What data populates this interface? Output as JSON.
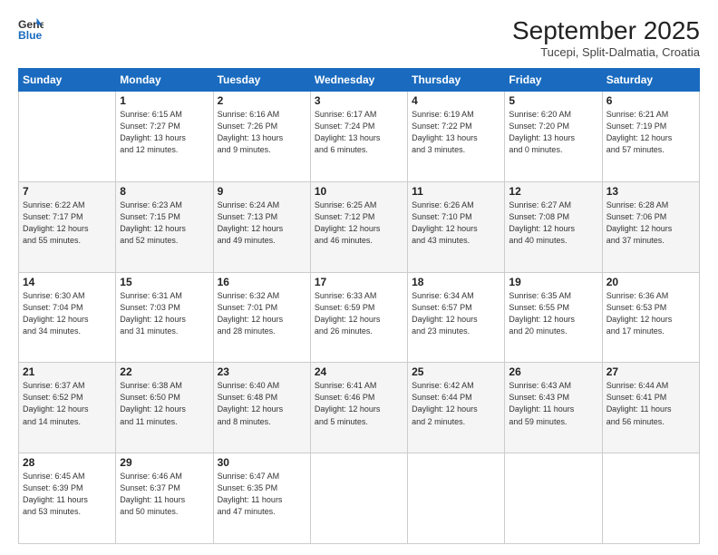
{
  "header": {
    "logo_line1": "General",
    "logo_line2": "Blue",
    "month_title": "September 2025",
    "subtitle": "Tucepi, Split-Dalmatia, Croatia"
  },
  "weekdays": [
    "Sunday",
    "Monday",
    "Tuesday",
    "Wednesday",
    "Thursday",
    "Friday",
    "Saturday"
  ],
  "weeks": [
    [
      {
        "day": "",
        "info": ""
      },
      {
        "day": "1",
        "info": "Sunrise: 6:15 AM\nSunset: 7:27 PM\nDaylight: 13 hours\nand 12 minutes."
      },
      {
        "day": "2",
        "info": "Sunrise: 6:16 AM\nSunset: 7:26 PM\nDaylight: 13 hours\nand 9 minutes."
      },
      {
        "day": "3",
        "info": "Sunrise: 6:17 AM\nSunset: 7:24 PM\nDaylight: 13 hours\nand 6 minutes."
      },
      {
        "day": "4",
        "info": "Sunrise: 6:19 AM\nSunset: 7:22 PM\nDaylight: 13 hours\nand 3 minutes."
      },
      {
        "day": "5",
        "info": "Sunrise: 6:20 AM\nSunset: 7:20 PM\nDaylight: 13 hours\nand 0 minutes."
      },
      {
        "day": "6",
        "info": "Sunrise: 6:21 AM\nSunset: 7:19 PM\nDaylight: 12 hours\nand 57 minutes."
      }
    ],
    [
      {
        "day": "7",
        "info": "Sunrise: 6:22 AM\nSunset: 7:17 PM\nDaylight: 12 hours\nand 55 minutes."
      },
      {
        "day": "8",
        "info": "Sunrise: 6:23 AM\nSunset: 7:15 PM\nDaylight: 12 hours\nand 52 minutes."
      },
      {
        "day": "9",
        "info": "Sunrise: 6:24 AM\nSunset: 7:13 PM\nDaylight: 12 hours\nand 49 minutes."
      },
      {
        "day": "10",
        "info": "Sunrise: 6:25 AM\nSunset: 7:12 PM\nDaylight: 12 hours\nand 46 minutes."
      },
      {
        "day": "11",
        "info": "Sunrise: 6:26 AM\nSunset: 7:10 PM\nDaylight: 12 hours\nand 43 minutes."
      },
      {
        "day": "12",
        "info": "Sunrise: 6:27 AM\nSunset: 7:08 PM\nDaylight: 12 hours\nand 40 minutes."
      },
      {
        "day": "13",
        "info": "Sunrise: 6:28 AM\nSunset: 7:06 PM\nDaylight: 12 hours\nand 37 minutes."
      }
    ],
    [
      {
        "day": "14",
        "info": "Sunrise: 6:30 AM\nSunset: 7:04 PM\nDaylight: 12 hours\nand 34 minutes."
      },
      {
        "day": "15",
        "info": "Sunrise: 6:31 AM\nSunset: 7:03 PM\nDaylight: 12 hours\nand 31 minutes."
      },
      {
        "day": "16",
        "info": "Sunrise: 6:32 AM\nSunset: 7:01 PM\nDaylight: 12 hours\nand 28 minutes."
      },
      {
        "day": "17",
        "info": "Sunrise: 6:33 AM\nSunset: 6:59 PM\nDaylight: 12 hours\nand 26 minutes."
      },
      {
        "day": "18",
        "info": "Sunrise: 6:34 AM\nSunset: 6:57 PM\nDaylight: 12 hours\nand 23 minutes."
      },
      {
        "day": "19",
        "info": "Sunrise: 6:35 AM\nSunset: 6:55 PM\nDaylight: 12 hours\nand 20 minutes."
      },
      {
        "day": "20",
        "info": "Sunrise: 6:36 AM\nSunset: 6:53 PM\nDaylight: 12 hours\nand 17 minutes."
      }
    ],
    [
      {
        "day": "21",
        "info": "Sunrise: 6:37 AM\nSunset: 6:52 PM\nDaylight: 12 hours\nand 14 minutes."
      },
      {
        "day": "22",
        "info": "Sunrise: 6:38 AM\nSunset: 6:50 PM\nDaylight: 12 hours\nand 11 minutes."
      },
      {
        "day": "23",
        "info": "Sunrise: 6:40 AM\nSunset: 6:48 PM\nDaylight: 12 hours\nand 8 minutes."
      },
      {
        "day": "24",
        "info": "Sunrise: 6:41 AM\nSunset: 6:46 PM\nDaylight: 12 hours\nand 5 minutes."
      },
      {
        "day": "25",
        "info": "Sunrise: 6:42 AM\nSunset: 6:44 PM\nDaylight: 12 hours\nand 2 minutes."
      },
      {
        "day": "26",
        "info": "Sunrise: 6:43 AM\nSunset: 6:43 PM\nDaylight: 11 hours\nand 59 minutes."
      },
      {
        "day": "27",
        "info": "Sunrise: 6:44 AM\nSunset: 6:41 PM\nDaylight: 11 hours\nand 56 minutes."
      }
    ],
    [
      {
        "day": "28",
        "info": "Sunrise: 6:45 AM\nSunset: 6:39 PM\nDaylight: 11 hours\nand 53 minutes."
      },
      {
        "day": "29",
        "info": "Sunrise: 6:46 AM\nSunset: 6:37 PM\nDaylight: 11 hours\nand 50 minutes."
      },
      {
        "day": "30",
        "info": "Sunrise: 6:47 AM\nSunset: 6:35 PM\nDaylight: 11 hours\nand 47 minutes."
      },
      {
        "day": "",
        "info": ""
      },
      {
        "day": "",
        "info": ""
      },
      {
        "day": "",
        "info": ""
      },
      {
        "day": "",
        "info": ""
      }
    ]
  ]
}
